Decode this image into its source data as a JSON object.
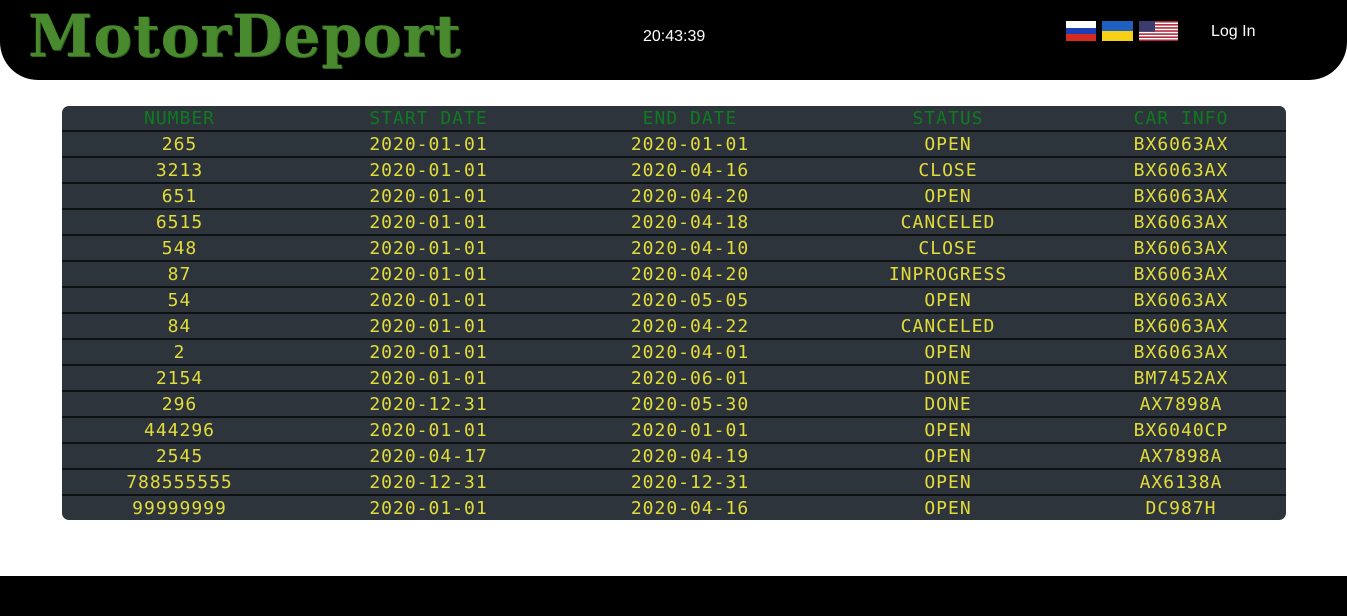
{
  "header": {
    "logo": "MotorDeport",
    "clock": "20:43:39",
    "login_label": "Log In",
    "flags": [
      "russia-flag-icon",
      "ukraine-flag-icon",
      "usa-flag-icon"
    ]
  },
  "colors": {
    "header_bg": "#000000",
    "logo_green": "#4a8a2e",
    "table_bg": "#2e343c",
    "header_text": "#0f7a1f",
    "cell_text": "#e2dc3a"
  },
  "table": {
    "columns": [
      "NUMBER",
      "START DATE",
      "END DATE",
      "STATUS",
      "CAR INFO"
    ],
    "rows": [
      [
        "265",
        "2020-01-01",
        "2020-01-01",
        "OPEN",
        "BX6063AX"
      ],
      [
        "3213",
        "2020-01-01",
        "2020-04-16",
        "CLOSE",
        "BX6063AX"
      ],
      [
        "651",
        "2020-01-01",
        "2020-04-20",
        "OPEN",
        "BX6063AX"
      ],
      [
        "6515",
        "2020-01-01",
        "2020-04-18",
        "CANCELED",
        "BX6063AX"
      ],
      [
        "548",
        "2020-01-01",
        "2020-04-10",
        "CLOSE",
        "BX6063AX"
      ],
      [
        "87",
        "2020-01-01",
        "2020-04-20",
        "INPROGRESS",
        "BX6063AX"
      ],
      [
        "54",
        "2020-01-01",
        "2020-05-05",
        "OPEN",
        "BX6063AX"
      ],
      [
        "84",
        "2020-01-01",
        "2020-04-22",
        "CANCELED",
        "BX6063AX"
      ],
      [
        "2",
        "2020-01-01",
        "2020-04-01",
        "OPEN",
        "BX6063AX"
      ],
      [
        "2154",
        "2020-01-01",
        "2020-06-01",
        "DONE",
        "BM7452AX"
      ],
      [
        "296",
        "2020-12-31",
        "2020-05-30",
        "DONE",
        "AX7898A"
      ],
      [
        "444296",
        "2020-01-01",
        "2020-01-01",
        "OPEN",
        "BX6040CP"
      ],
      [
        "2545",
        "2020-04-17",
        "2020-04-19",
        "OPEN",
        "AX7898A"
      ],
      [
        "788555555",
        "2020-12-31",
        "2020-12-31",
        "OPEN",
        "AX6138A"
      ],
      [
        "99999999",
        "2020-01-01",
        "2020-04-16",
        "OPEN",
        "DC987H"
      ]
    ]
  }
}
